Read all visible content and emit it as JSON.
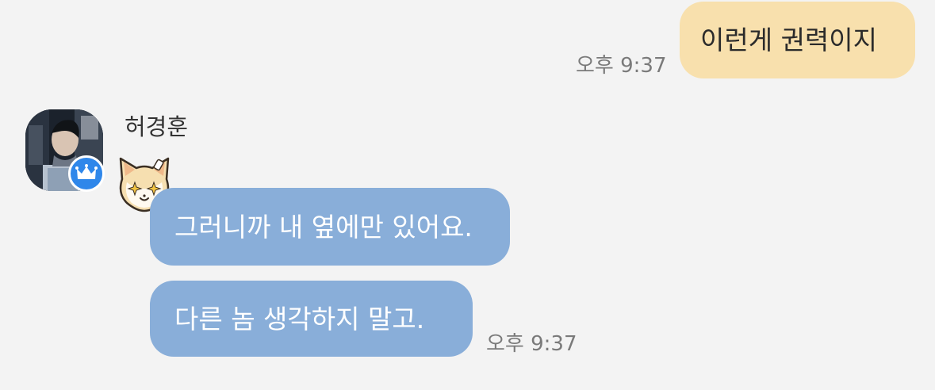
{
  "messages": {
    "outgoing": {
      "text": "이런게 권력이지",
      "time": "오후 9:37"
    },
    "incoming": {
      "sender": "허경훈",
      "first": "그러니까 내 옆에만 있어요.",
      "second": "다른 놈 생각하지 말고.",
      "time": "오후 9:37"
    }
  },
  "colors": {
    "background": "#f3f3f3",
    "outgoing_bubble": "#f8e0ad",
    "incoming_bubble": "#89aed9",
    "badge": "#2f87ea"
  },
  "icons": {
    "avatar": "profile-photo",
    "badge": "crown-icon",
    "sticker": "cat-sticker-icon"
  }
}
